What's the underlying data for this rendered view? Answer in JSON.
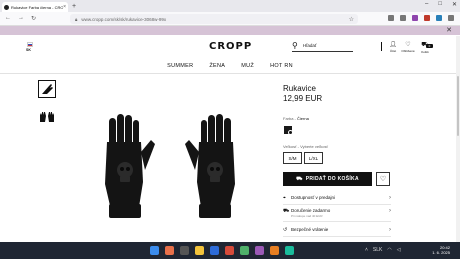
{
  "browser": {
    "tab_title": "Rukavice Farba čierna - CROPP",
    "url": "www.cropp.com/sk/sk/rukavice-3068w-99x",
    "new_tab": "+",
    "tab_close": "×"
  },
  "site": {
    "country": "SK",
    "logo": "CROPP",
    "search_placeholder": "Hľadať",
    "account_label": "Účet",
    "wishlist_label": "Obľúbené",
    "cart_label": "Košík",
    "cart_count": "0",
    "menu": [
      "SUMMER",
      "ŽENA",
      "MUŽ",
      "HOT RN"
    ]
  },
  "product": {
    "title": "Rukavice",
    "price": "12,99 EUR",
    "color_label": "Farba -",
    "color_value": "Čierna",
    "size_label": "Veľkosť - Vyberte veľkosť",
    "sizes": [
      "S/M",
      "L/XL"
    ],
    "buy_label": "PRIDAŤ DO KOŠÍKA",
    "info": [
      {
        "label": "Dostupnosť v predajni",
        "sub": ""
      },
      {
        "label": "Doručenie zadarmo",
        "sub": "Pri nákupe nad 40 EUR"
      },
      {
        "label": "Bezpečné vrátenie",
        "sub": ""
      }
    ]
  },
  "taskbar": {
    "lang": "SLK",
    "time": "20:42",
    "date": "1. 6. 2025"
  },
  "colors": {
    "promo_bg": "#d6c3d6",
    "accent": "#111111",
    "taskbar_bg": "#1f2633"
  }
}
